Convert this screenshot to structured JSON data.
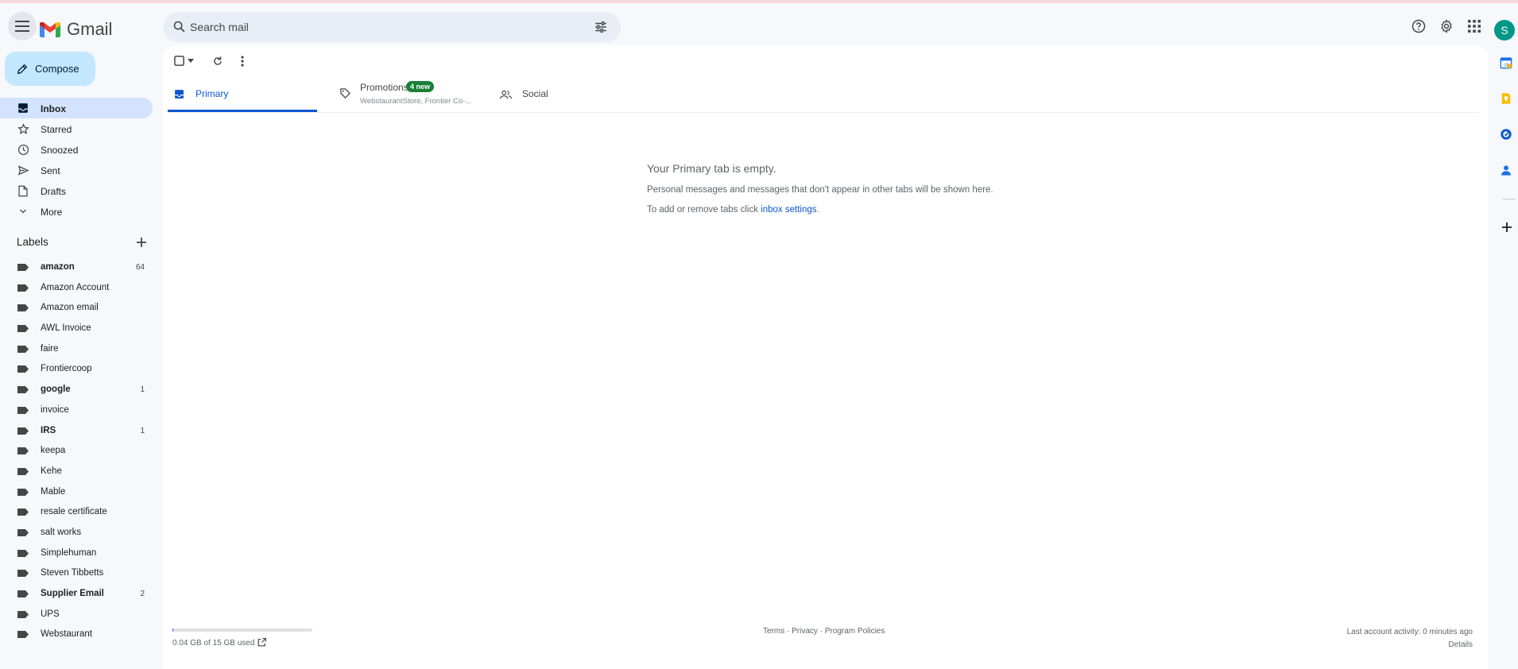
{
  "app": {
    "name": "Gmail"
  },
  "header": {
    "search_placeholder": "Search mail",
    "avatar_letter": "S",
    "icons": [
      "menu-icon",
      "gmail-logo",
      "search-icon",
      "filter-options-icon",
      "help-icon",
      "settings-icon",
      "apps-grid-icon"
    ]
  },
  "compose": {
    "label": "Compose"
  },
  "nav": {
    "items": [
      {
        "label": "Inbox",
        "icon": "inbox-icon",
        "active": true
      },
      {
        "label": "Starred",
        "icon": "star-icon"
      },
      {
        "label": "Snoozed",
        "icon": "clock-icon"
      },
      {
        "label": "Sent",
        "icon": "send-icon"
      },
      {
        "label": "Drafts",
        "icon": "draft-icon"
      },
      {
        "label": "More",
        "icon": "chevron-down-icon"
      }
    ]
  },
  "labels": {
    "header": "Labels",
    "items": [
      {
        "label": "amazon",
        "count": "64",
        "bold": true
      },
      {
        "label": "Amazon Account",
        "count": ""
      },
      {
        "label": "Amazon email",
        "count": ""
      },
      {
        "label": "AWL Invoice",
        "count": ""
      },
      {
        "label": "faire",
        "count": ""
      },
      {
        "label": "Frontiercoop",
        "count": ""
      },
      {
        "label": "google",
        "count": "1",
        "bold": true
      },
      {
        "label": "invoice",
        "count": ""
      },
      {
        "label": "IRS",
        "count": "1",
        "bold": true
      },
      {
        "label": "keepa",
        "count": ""
      },
      {
        "label": "Kehe",
        "count": ""
      },
      {
        "label": "Mable",
        "count": ""
      },
      {
        "label": "resale certificate",
        "count": ""
      },
      {
        "label": "salt works",
        "count": ""
      },
      {
        "label": "Simplehuman",
        "count": ""
      },
      {
        "label": "Steven Tibbetts",
        "count": ""
      },
      {
        "label": "Supplier Email",
        "count": "2",
        "bold": true
      },
      {
        "label": "UPS",
        "count": ""
      },
      {
        "label": "Webstaurant",
        "count": ""
      }
    ]
  },
  "tabs": [
    {
      "label": "Primary",
      "icon": "inbox-tab-icon",
      "active": true
    },
    {
      "label": "Promotions",
      "icon": "tag-icon",
      "badge": "4 new",
      "subtitle": "WebstaurantStore, Frontier Co-..."
    },
    {
      "label": "Social",
      "icon": "people-icon"
    }
  ],
  "empty_state": {
    "title": "Your Primary tab is empty.",
    "line1": "Personal messages and messages that don't appear in other tabs will be shown here.",
    "line2_prefix": "To add or remove tabs click ",
    "line2_link": "inbox settings",
    "line2_suffix": "."
  },
  "footer": {
    "storage": "0.04 GB of 15 GB used",
    "storage_fraction": 0.003,
    "links": "Terms · Privacy · Program Policies",
    "activity": "Last account activity: 0 minutes ago",
    "details": "Details"
  },
  "colors": {
    "accent": "#0b57d0",
    "compose_bg": "#c2e7ff",
    "active_nav": "#d3e3fd",
    "badge": "#188038",
    "avatar": "#009688"
  }
}
